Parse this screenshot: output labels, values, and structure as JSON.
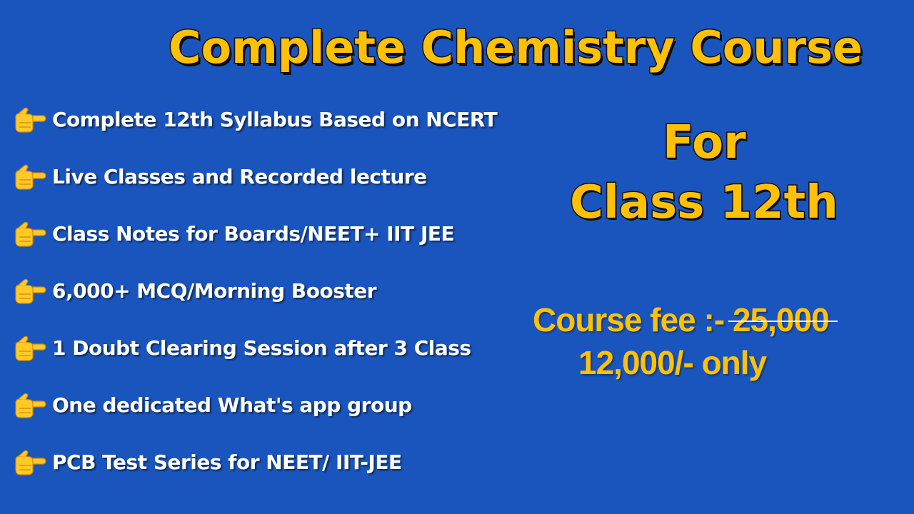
{
  "title": "Complete Chemistry Course",
  "features": [
    {
      "icon": "pointing-hand-icon",
      "text": "Complete 12th Syllabus Based on NCERT"
    },
    {
      "icon": "pointing-hand-icon",
      "text": "Live Classes and Recorded lecture"
    },
    {
      "icon": "pointing-hand-icon",
      "text": "Class Notes for Boards/NEET+ IIT JEE"
    },
    {
      "icon": "pointing-hand-icon",
      "text": "6,000+ MCQ/Morning Booster"
    },
    {
      "icon": "pointing-hand-icon",
      "text": "1 Doubt Clearing Session after 3 Class"
    },
    {
      "icon": "pointing-hand-icon",
      "text": "One dedicated What's app group"
    },
    {
      "icon": "pointing-hand-icon",
      "text": "PCB Test Series for NEET/ IIT-JEE"
    }
  ],
  "audience": {
    "for_label": "For",
    "class_label": "Class 12th"
  },
  "pricing": {
    "fee_label": "Course fee :-",
    "original_price": "25,000",
    "offer_price": "12,000/- only"
  },
  "colors": {
    "background": "#1a55be",
    "accent_yellow": "#ffc107",
    "text_white": "#ffffff",
    "outline": "#111111"
  }
}
